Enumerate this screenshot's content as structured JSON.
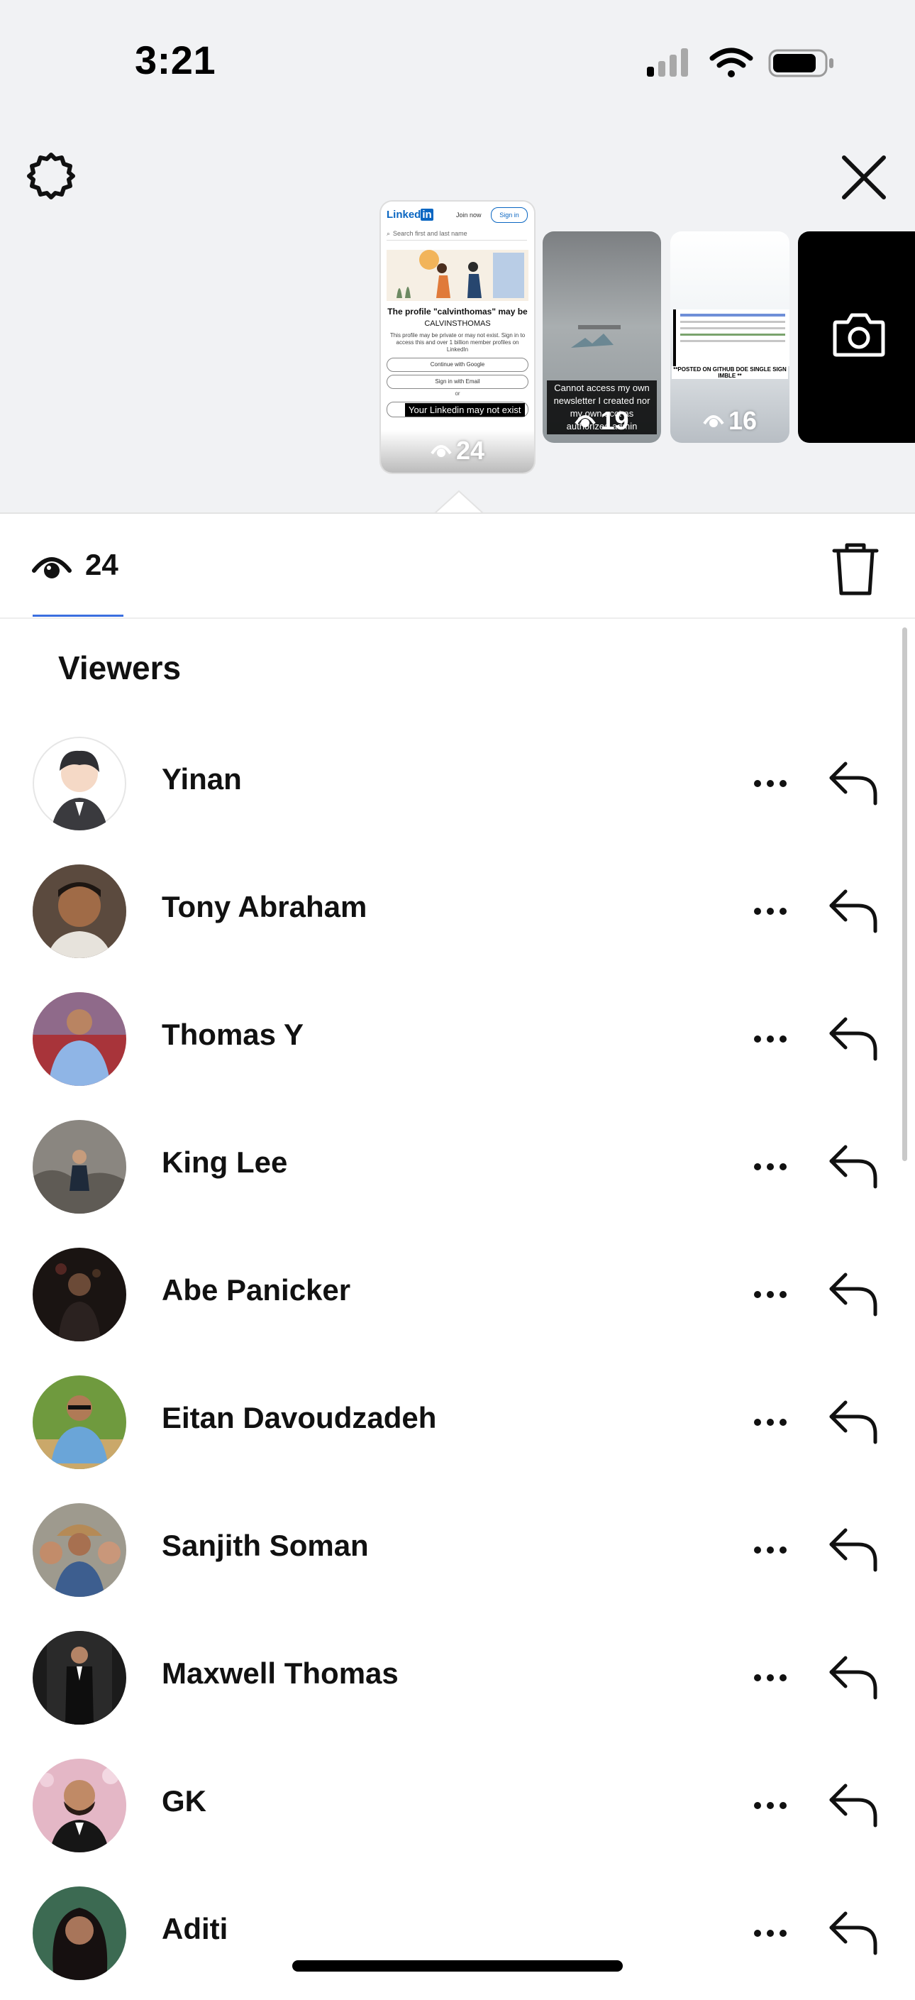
{
  "status_bar": {
    "time": "3:21"
  },
  "story_strip": {
    "selected_views": "24",
    "thumbnails": [
      {
        "views": "24",
        "brand": "Linked",
        "brand_in": "in",
        "join_now": "Join now",
        "sign_in": "Sign in",
        "search_placeholder": "Search first and last name",
        "heading": "The profile \"calvinthomas\" may be",
        "handle": "CALVINSTHOMAS",
        "body_line1": "This profile may be private or may not exist. Sign in to",
        "body_line2": "access this and over 1 billion member profiles on",
        "body_line3": "LinkedIn",
        "google_button": "Continue with Google",
        "email_button": "Sign in with Email",
        "or": "or",
        "caption": "Your Linkedin may not exist"
      },
      {
        "views": "19",
        "caption": "Cannot access my own newsletter I created nor my own acct as authorized admin"
      },
      {
        "views": "16",
        "caption": "**POSTED ON GITHUB DOE SINGLE SIGN IMBLE **"
      },
      {
        "type": "camera"
      }
    ]
  },
  "stats": {
    "view_count": "24"
  },
  "viewers": {
    "title": "Viewers",
    "list": [
      {
        "name": "Yinan"
      },
      {
        "name": "Tony Abraham"
      },
      {
        "name": "Thomas Y"
      },
      {
        "name": "King Lee"
      },
      {
        "name": "Abe Panicker"
      },
      {
        "name": "Eitan Davoudzadeh"
      },
      {
        "name": "Sanjith Soman"
      },
      {
        "name": "Maxwell Thomas"
      },
      {
        "name": "GK"
      },
      {
        "name": "Aditi"
      }
    ]
  },
  "colors": {
    "top_background": "#f1f2f4",
    "accent": "#3b6fe0",
    "text": "#111111"
  },
  "icons": [
    "gear-icon",
    "close-icon",
    "eye-icon",
    "trash-icon",
    "more-icon",
    "reply-icon",
    "camera-icon",
    "signal-icon",
    "wifi-icon",
    "battery-icon"
  ]
}
